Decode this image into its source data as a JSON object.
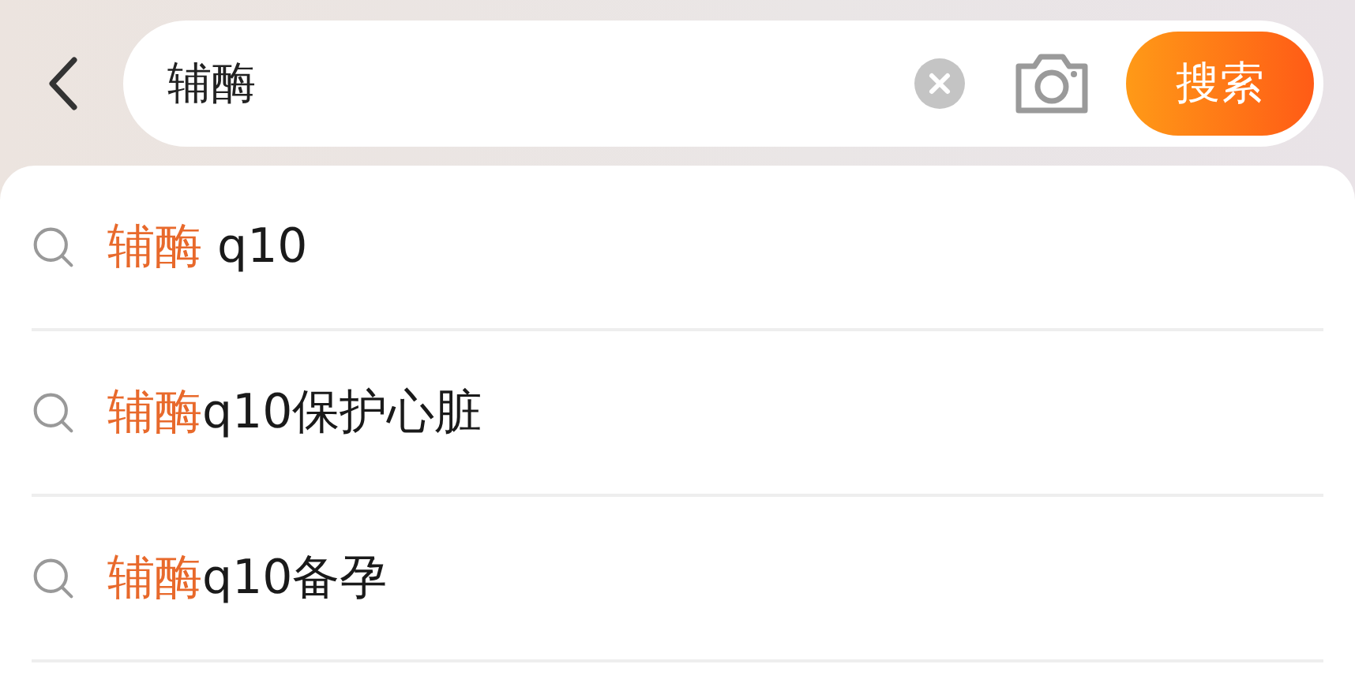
{
  "search": {
    "value": "辅酶",
    "button": "搜索"
  },
  "suggestions": [
    {
      "match": "辅酶",
      "rest": " q10"
    },
    {
      "match": "辅酶",
      "rest": "q10保护心脏"
    },
    {
      "match": "辅酶",
      "rest": "q10备孕"
    }
  ]
}
